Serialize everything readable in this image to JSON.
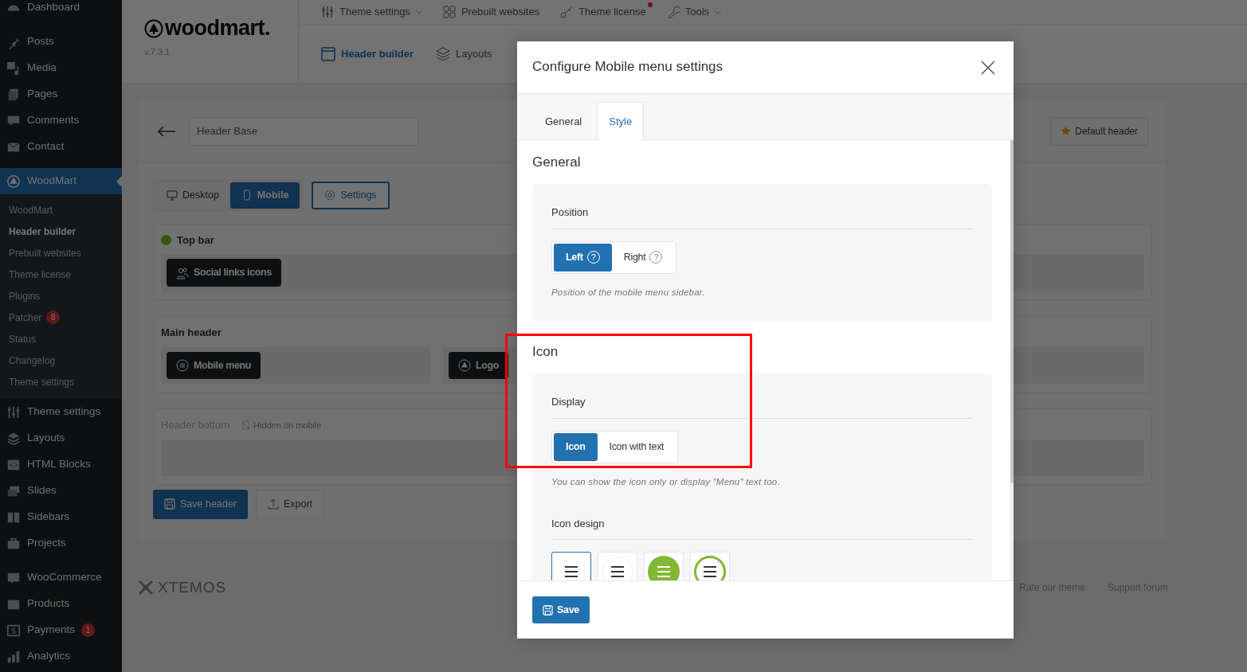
{
  "sidebar": {
    "groups": [
      {
        "items": [
          {
            "label": "Dashboard",
            "selected": false
          }
        ]
      },
      {
        "items": [
          {
            "label": "Posts",
            "selected": false
          },
          {
            "label": "Media",
            "selected": false
          },
          {
            "label": "Pages",
            "selected": false
          },
          {
            "label": "Comments",
            "selected": false
          },
          {
            "label": "Contact",
            "selected": false
          }
        ]
      },
      {
        "items": [
          {
            "label": "WoodMart",
            "selected": true,
            "children": [
              {
                "label": "WoodMart",
                "selected": false
              },
              {
                "label": "Header builder",
                "selected": true
              },
              {
                "label": "Prebuilt websites",
                "selected": false
              },
              {
                "label": "Theme license",
                "selected": false
              },
              {
                "label": "Plugins",
                "selected": false
              },
              {
                "label": "Patcher",
                "selected": false,
                "badge": "8"
              },
              {
                "label": "Status",
                "selected": false
              },
              {
                "label": "Changelog",
                "selected": false
              },
              {
                "label": "Theme settings",
                "selected": false
              }
            ]
          },
          {
            "label": "Theme settings",
            "selected": false
          },
          {
            "label": "Layouts",
            "selected": false
          },
          {
            "label": "HTML Blocks",
            "selected": false
          },
          {
            "label": "Slides",
            "selected": false
          },
          {
            "label": "Sidebars",
            "selected": false
          },
          {
            "label": "Projects",
            "selected": false
          }
        ]
      },
      {
        "items": [
          {
            "label": "WooCommerce",
            "selected": false
          },
          {
            "label": "Products",
            "selected": false
          },
          {
            "label": "Payments",
            "selected": false,
            "badge": "1"
          },
          {
            "label": "Analytics",
            "selected": false
          }
        ]
      }
    ]
  },
  "brand": {
    "logo": "woodmart.",
    "version": "v.7.3.1"
  },
  "top_nav": [
    {
      "label": "Theme settings",
      "dropdown": true,
      "notice": false
    },
    {
      "label": "Prebuilt websites",
      "dropdown": false,
      "notice": false
    },
    {
      "label": "Theme license",
      "dropdown": false,
      "notice": true
    },
    {
      "label": "Tools",
      "dropdown": true,
      "notice": false
    }
  ],
  "sub_nav": [
    {
      "label": "Header builder",
      "selected": true
    },
    {
      "label": "Layouts",
      "selected": false
    }
  ],
  "builder": {
    "name": {
      "value": "Header Base"
    },
    "default_button": "Default header",
    "devices": [
      {
        "label": "Desktop",
        "selected": false
      },
      {
        "label": "Mobile",
        "selected": true
      }
    ],
    "settings_button": "Settings",
    "rows": [
      {
        "title": "Top bar",
        "active": true,
        "hidden_note": null,
        "elements": [
          {
            "label": "Social links icons",
            "kind": "social"
          }
        ],
        "right_elements": []
      },
      {
        "title": "Main header",
        "active": false,
        "hidden_note": null,
        "elements": [
          {
            "label": "Mobile menu",
            "kind": "menu"
          }
        ],
        "right_elements": [
          {
            "label": "Logo",
            "kind": "logo"
          }
        ]
      },
      {
        "title": "Header bottom",
        "active": false,
        "hidden_note": "Hidden on mobile",
        "elements": [],
        "right_elements": []
      }
    ],
    "save_button": "Save header",
    "export_button": "Export"
  },
  "footer": {
    "brand": "XTEMOS",
    "links": [
      "Rate our theme",
      "Support forum"
    ]
  },
  "modal": {
    "title": "Configure Mobile menu settings",
    "tabs": [
      {
        "label": "General",
        "selected": false
      },
      {
        "label": "Style",
        "selected": true
      }
    ],
    "sections": [
      {
        "title": "General",
        "fields": [
          {
            "label": "Position",
            "options": [
              {
                "label": "Left",
                "help": "?",
                "selected": true
              },
              {
                "label": "Right",
                "help": "?",
                "selected": false
              }
            ],
            "hint": "Position of the mobile menu sidebar."
          }
        ]
      },
      {
        "title": "Icon",
        "fields": [
          {
            "label": "Display",
            "options": [
              {
                "label": "Icon",
                "selected": true
              },
              {
                "label": "Icon with text",
                "selected": false
              }
            ],
            "hint": "You can show the icon only or display \"Menu\" text too."
          },
          {
            "label": "Icon design",
            "designs": [
              {
                "kind": "plain",
                "selected": true
              },
              {
                "kind": "circle",
                "selected": false
              },
              {
                "kind": "filled",
                "selected": false
              },
              {
                "kind": "ring",
                "selected": false
              }
            ]
          }
        ]
      }
    ],
    "save_button": "Save"
  }
}
